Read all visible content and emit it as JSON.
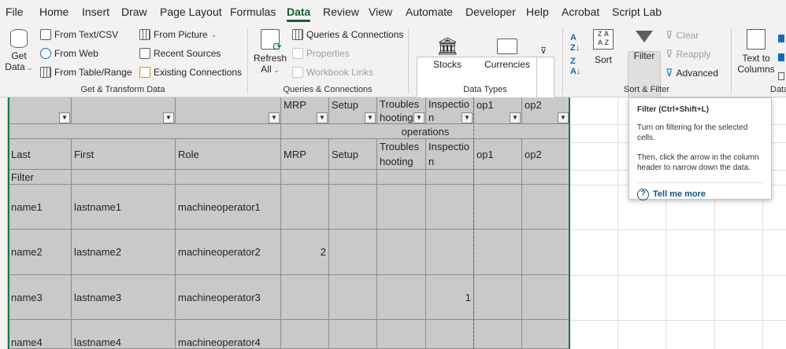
{
  "tabs": [
    "File",
    "Home",
    "Insert",
    "Draw",
    "Page Layout",
    "Formulas",
    "Data",
    "Review",
    "View",
    "Automate",
    "Developer",
    "Help",
    "Acrobat",
    "Script Lab"
  ],
  "ribbon": {
    "get_data": "Get\nData",
    "from_text_csv": "From Text/CSV",
    "from_web": "From Web",
    "from_table_range": "From Table/Range",
    "from_picture": "From Picture",
    "recent_sources": "Recent Sources",
    "existing_connections": "Existing Connections",
    "group_get_transform": "Get & Transform Data",
    "refresh_all": "Refresh\nAll",
    "queries_connections": "Queries & Connections",
    "properties": "Properties",
    "workbook_links": "Workbook Links",
    "group_queries": "Queries & Connections",
    "stocks": "Stocks",
    "currencies": "Currencies",
    "group_data_types": "Data Types",
    "sort": "Sort",
    "filter": "Filter",
    "clear": "Clear",
    "reapply": "Reapply",
    "advanced": "Advanced",
    "group_sort_filter": "Sort & Filter",
    "text_to_columns": "Text to\nColumns",
    "group_data_tools": "Data"
  },
  "sheet": {
    "row1": [
      "",
      "",
      "",
      "MRP",
      "Setup",
      "Troubles\nhooting",
      "Inspectio\nn",
      "op1",
      "op2"
    ],
    "row2": "operations",
    "row3": [
      "Last",
      "First",
      "Role",
      "MRP",
      "Setup",
      "Troubles\nhooting",
      "Inspectio\nn",
      "op1",
      "op2"
    ],
    "row4": "Filter",
    "rows": [
      [
        "name1",
        "lastname1",
        "machineoperator1",
        "",
        "",
        "",
        "",
        "",
        ""
      ],
      [
        "name2",
        "lastname2",
        "machineoperator2",
        "2",
        "",
        "",
        "",
        "",
        ""
      ],
      [
        "name3",
        "lastname3",
        "machineoperator3",
        "",
        "",
        "",
        "1",
        "",
        ""
      ],
      [
        "name4",
        "lastname4",
        "machineoperator4",
        "",
        "",
        "",
        "",
        "",
        ""
      ]
    ]
  },
  "tooltip": {
    "title": "Filter (Ctrl+Shift+L)",
    "line1": "Turn on filtering for the selected cells.",
    "line2": "Then, click the arrow in the column header to narrow down the data.",
    "more": "Tell me more"
  }
}
